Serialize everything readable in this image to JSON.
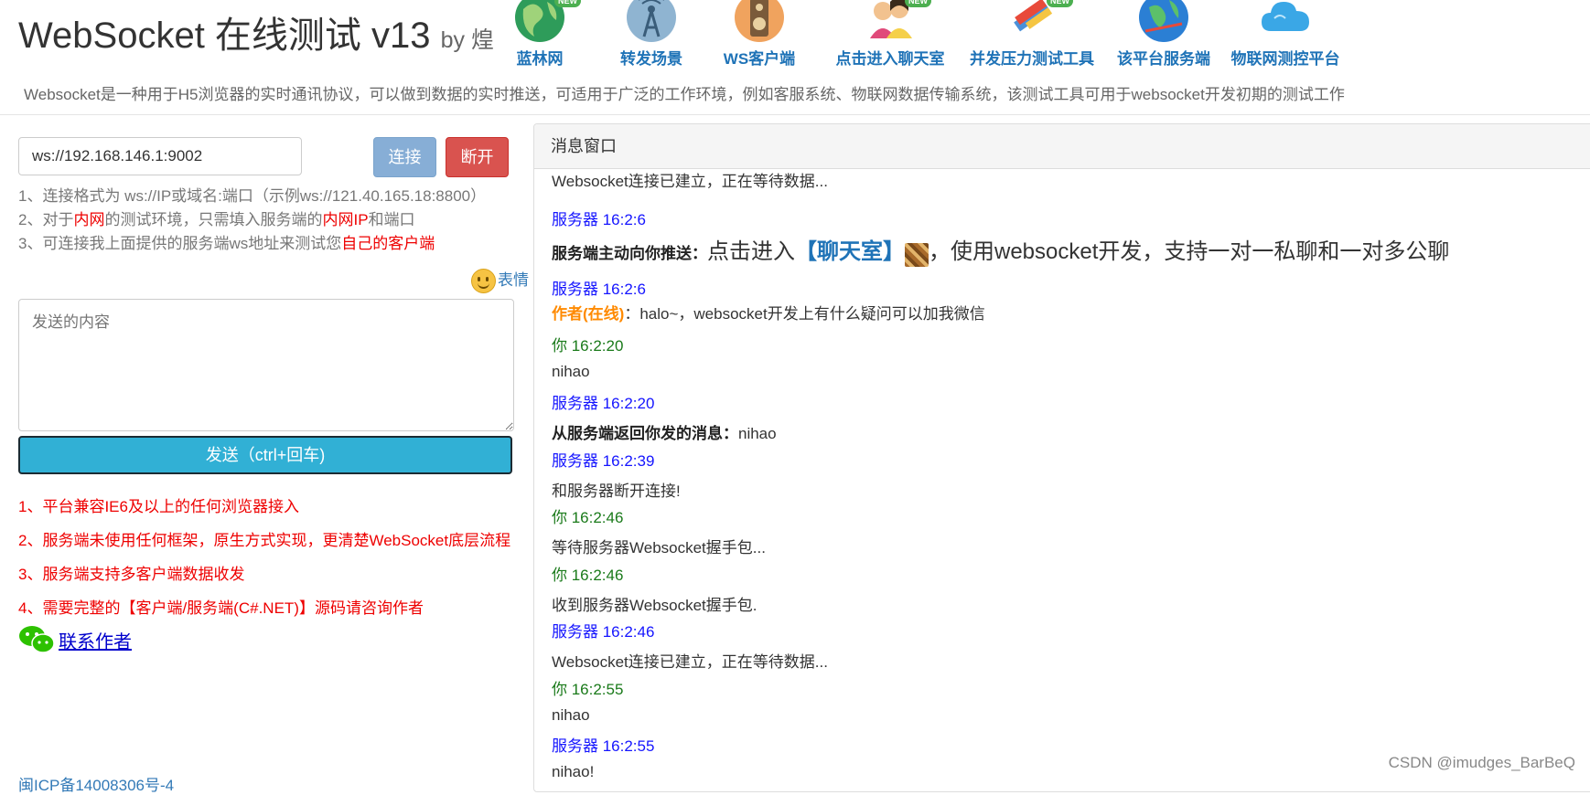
{
  "header": {
    "title": "WebSocket 在线测试 v13",
    "by": "by 煌",
    "description": "Websocket是一种用于H5浏览器的实时通讯协议，可以做到数据的实时推送，可适用于广泛的工作环境，例如客服系统、物联网数据传输系统，该测试工具可用于websocket开发初期的测试工作",
    "new_badge": "NEW",
    "nav": [
      {
        "label": "蓝林网",
        "icon": "globe-icon",
        "new": true
      },
      {
        "label": "转发场景",
        "icon": "antenna-icon",
        "new": false
      },
      {
        "label": "WS客户端",
        "icon": "speaker-icon",
        "new": false
      },
      {
        "label": "点击进入聊天室",
        "icon": "chat-users-icon",
        "new": true
      },
      {
        "label": "并发压力测试工具",
        "icon": "pencil-ruler-icon",
        "new": true
      },
      {
        "label": "该平台服务端",
        "icon": "earth-server-icon",
        "new": false
      },
      {
        "label": "物联网测控平台",
        "icon": "cloud-icon",
        "new": false
      }
    ]
  },
  "connection": {
    "url_value": "ws://192.168.146.1:9002",
    "connect_label": "连接",
    "disconnect_label": "断开"
  },
  "hints": {
    "line1": "1、连接格式为 ws://IP或域名:端口（示例ws://121.40.165.18:8800）",
    "line2_a": "2、对于",
    "line2_b": "内网",
    "line2_c": "的测试环境，只需填入服务端的",
    "line2_d": "内网IP",
    "line2_e": "和端口",
    "line3_a": "3、可连接我上面提供的服务端ws地址来测试您",
    "line3_b": "自己的客户端"
  },
  "emoji_label": "表情",
  "send": {
    "placeholder": "发送的内容",
    "button_label": "发送（ctrl+回车)"
  },
  "features": [
    "1、平台兼容IE6及以上的任何浏览器接入",
    "2、服务端未使用任何框架，原生方式实现，更清楚WebSocket底层流程",
    "3、服务端支持多客户端数据收发",
    "4、需要完整的【客户端/服务端(C#.NET)】源码请咨询作者"
  ],
  "contact_label": "联系作者",
  "icp": "闽ICP备14008306号-4",
  "panel": {
    "title": "消息窗口",
    "messages": [
      {
        "body": "Websocket连接已建立，正在等待数据..."
      },
      {
        "header": "服务器 16:2:6",
        "bold": "服务端主动向你推送：",
        "big_a": "点击进入",
        "link": "【聊天室】",
        "big_b": "，使用websocket开发，支持一对一私聊和一对多公聊"
      },
      {
        "header": "服务器 16:2:6",
        "author": "作者(在线)",
        "body": "：halo~，websocket开发上有什么疑问可以加我微信"
      },
      {
        "header": "你 16:2:20",
        "body": "nihao"
      },
      {
        "header": "服务器 16:2:20",
        "bold": "从服务端返回你发的消息：",
        "body": "nihao"
      },
      {
        "header": "服务器 16:2:39",
        "body": "和服务器断开连接!"
      },
      {
        "header": "你 16:2:46",
        "body": "等待服务器Websocket握手包..."
      },
      {
        "header": "你 16:2:46",
        "body": "收到服务器Websocket握手包."
      },
      {
        "header": "服务器 16:2:46",
        "body": "Websocket连接已建立，正在等待数据..."
      },
      {
        "header": "你 16:2:55",
        "body": "nihao"
      },
      {
        "header": "服务器 16:2:55",
        "body": "nihao!"
      }
    ]
  },
  "watermark": "CSDN @imudges_BarBeQ"
}
